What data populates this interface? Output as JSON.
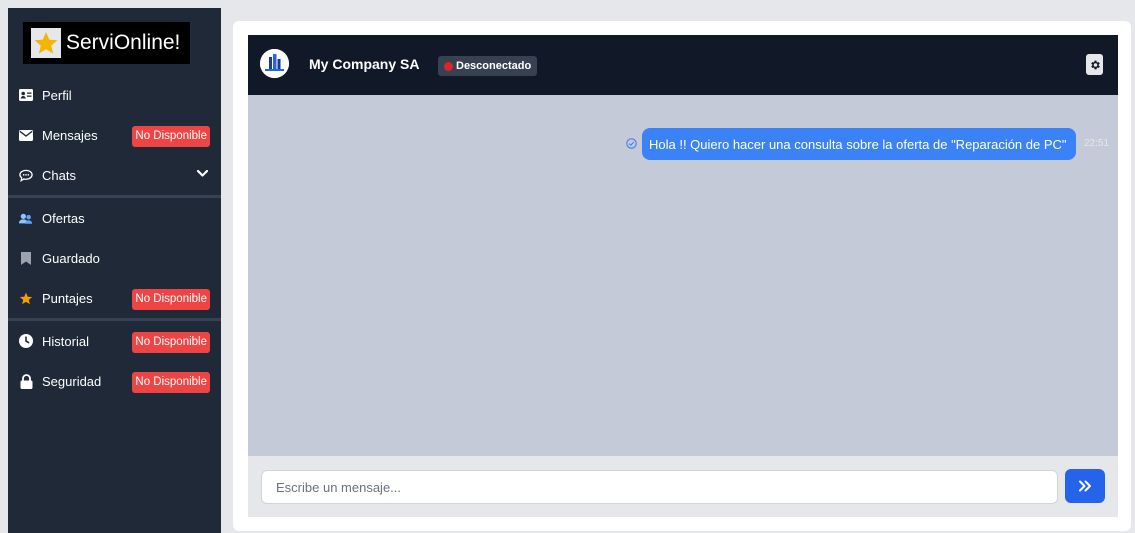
{
  "brand": {
    "name": "ServiOnline!",
    "icon": "star-icon"
  },
  "sidebar": {
    "unavailable_label": "No Disponible",
    "items": [
      {
        "label": "Perfil",
        "icon": "id-card-icon",
        "unavailable": false
      },
      {
        "label": "Mensajes",
        "icon": "envelope-icon",
        "unavailable": true
      },
      {
        "label": "Chats",
        "icon": "chat-bubbles-icon",
        "unavailable": false,
        "expandable": true
      },
      {
        "label": "Ofertas",
        "icon": "users-icon",
        "unavailable": false
      },
      {
        "label": "Guardado",
        "icon": "bookmark-icon",
        "unavailable": false
      },
      {
        "label": "Puntajes",
        "icon": "star-icon",
        "unavailable": true
      },
      {
        "label": "Historial",
        "icon": "clock-icon",
        "unavailable": true
      },
      {
        "label": "Seguridad",
        "icon": "lock-icon",
        "unavailable": true
      }
    ]
  },
  "chat": {
    "company_name": "My Company SA",
    "status": "Desconectado",
    "status_color": "#dc2626",
    "messages": [
      {
        "text": "Hola !! Quiero hacer una consulta sobre la oferta de \"Reparación de PC\"",
        "time": "22:51",
        "own": true
      }
    ],
    "input": {
      "placeholder": "Escribe un mensaje...",
      "value": ""
    },
    "send_icon": "double-chevron-right-icon"
  },
  "colors": {
    "accent": "#2563eb",
    "bubble": "#3b82f6",
    "danger": "#ef4444",
    "sidebar": "#1f2937"
  }
}
